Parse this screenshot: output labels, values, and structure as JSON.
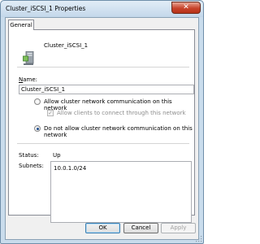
{
  "window": {
    "title": "Cluster_iSCSI_1 Properties"
  },
  "tabs": [
    {
      "label": "General"
    }
  ],
  "resource": {
    "name": "Cluster_iSCSI_1"
  },
  "name_field": {
    "label": "Name:",
    "value": "Cluster_iSCSI_1"
  },
  "options": {
    "allow_cluster": "Allow cluster network communication on this network",
    "allow_clients": "Allow clients to connect through this network",
    "do_not_allow": "Do not allow cluster network communication on this network",
    "selected": "do_not_allow"
  },
  "status": {
    "label": "Status:",
    "value": "Up"
  },
  "subnets": {
    "label": "Subnets:",
    "items": [
      "10.0.1.0/24"
    ]
  },
  "buttons": {
    "ok": "OK",
    "cancel": "Cancel",
    "apply": "Apply"
  },
  "colors": {
    "titlebar": "#c3d7ea",
    "close": "#c7432a",
    "default_button": "#3c7fb1"
  }
}
